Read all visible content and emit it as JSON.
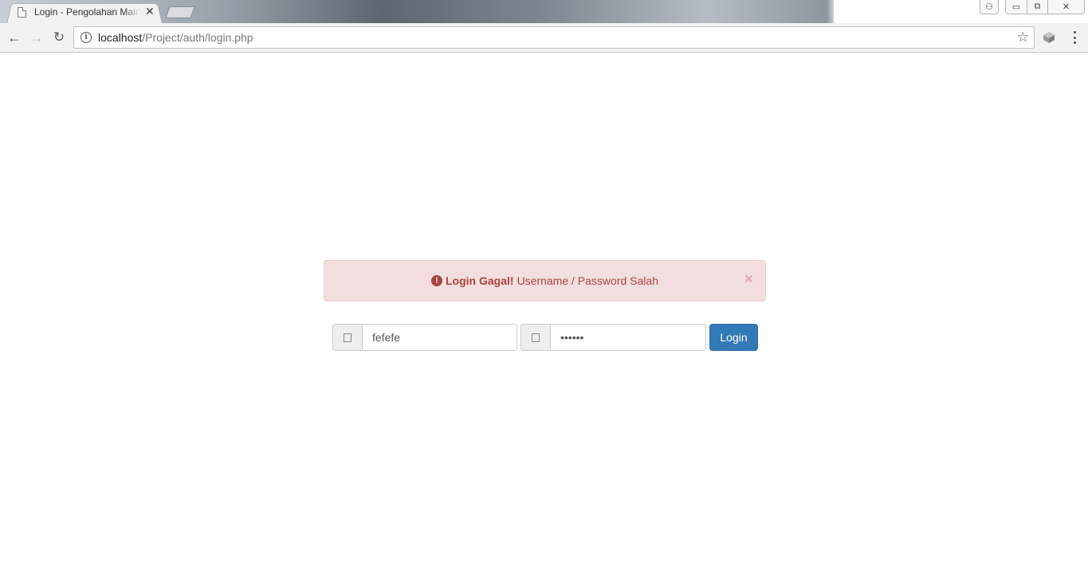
{
  "browser": {
    "tab": {
      "title": "Login - Pengolahan Main",
      "close_glyph": "✕"
    },
    "nav": {
      "back_glyph": "←",
      "forward_glyph": "→",
      "reload_glyph": "↻"
    },
    "url": {
      "host": "localhost",
      "path": "/Project/auth/login.php"
    },
    "icons": {
      "info": "i",
      "star": "☆"
    },
    "window": {
      "user_glyph": "⚇",
      "minimize_glyph": "▭",
      "maximize_glyph": "⧉",
      "close_glyph": "✕"
    }
  },
  "alert": {
    "icon": "!",
    "strong": "Login Gagal!",
    "message": "Username / Password Salah",
    "close": "×",
    "colors": {
      "background": "#f2dede",
      "border": "#ebccd1",
      "text": "#a94442"
    }
  },
  "login_form": {
    "username": {
      "value": "fefefe",
      "icon": "user-icon"
    },
    "password": {
      "value": "••••••",
      "icon": "lock-icon"
    },
    "submit_label": "Login",
    "accent_color": "#337ab7"
  }
}
